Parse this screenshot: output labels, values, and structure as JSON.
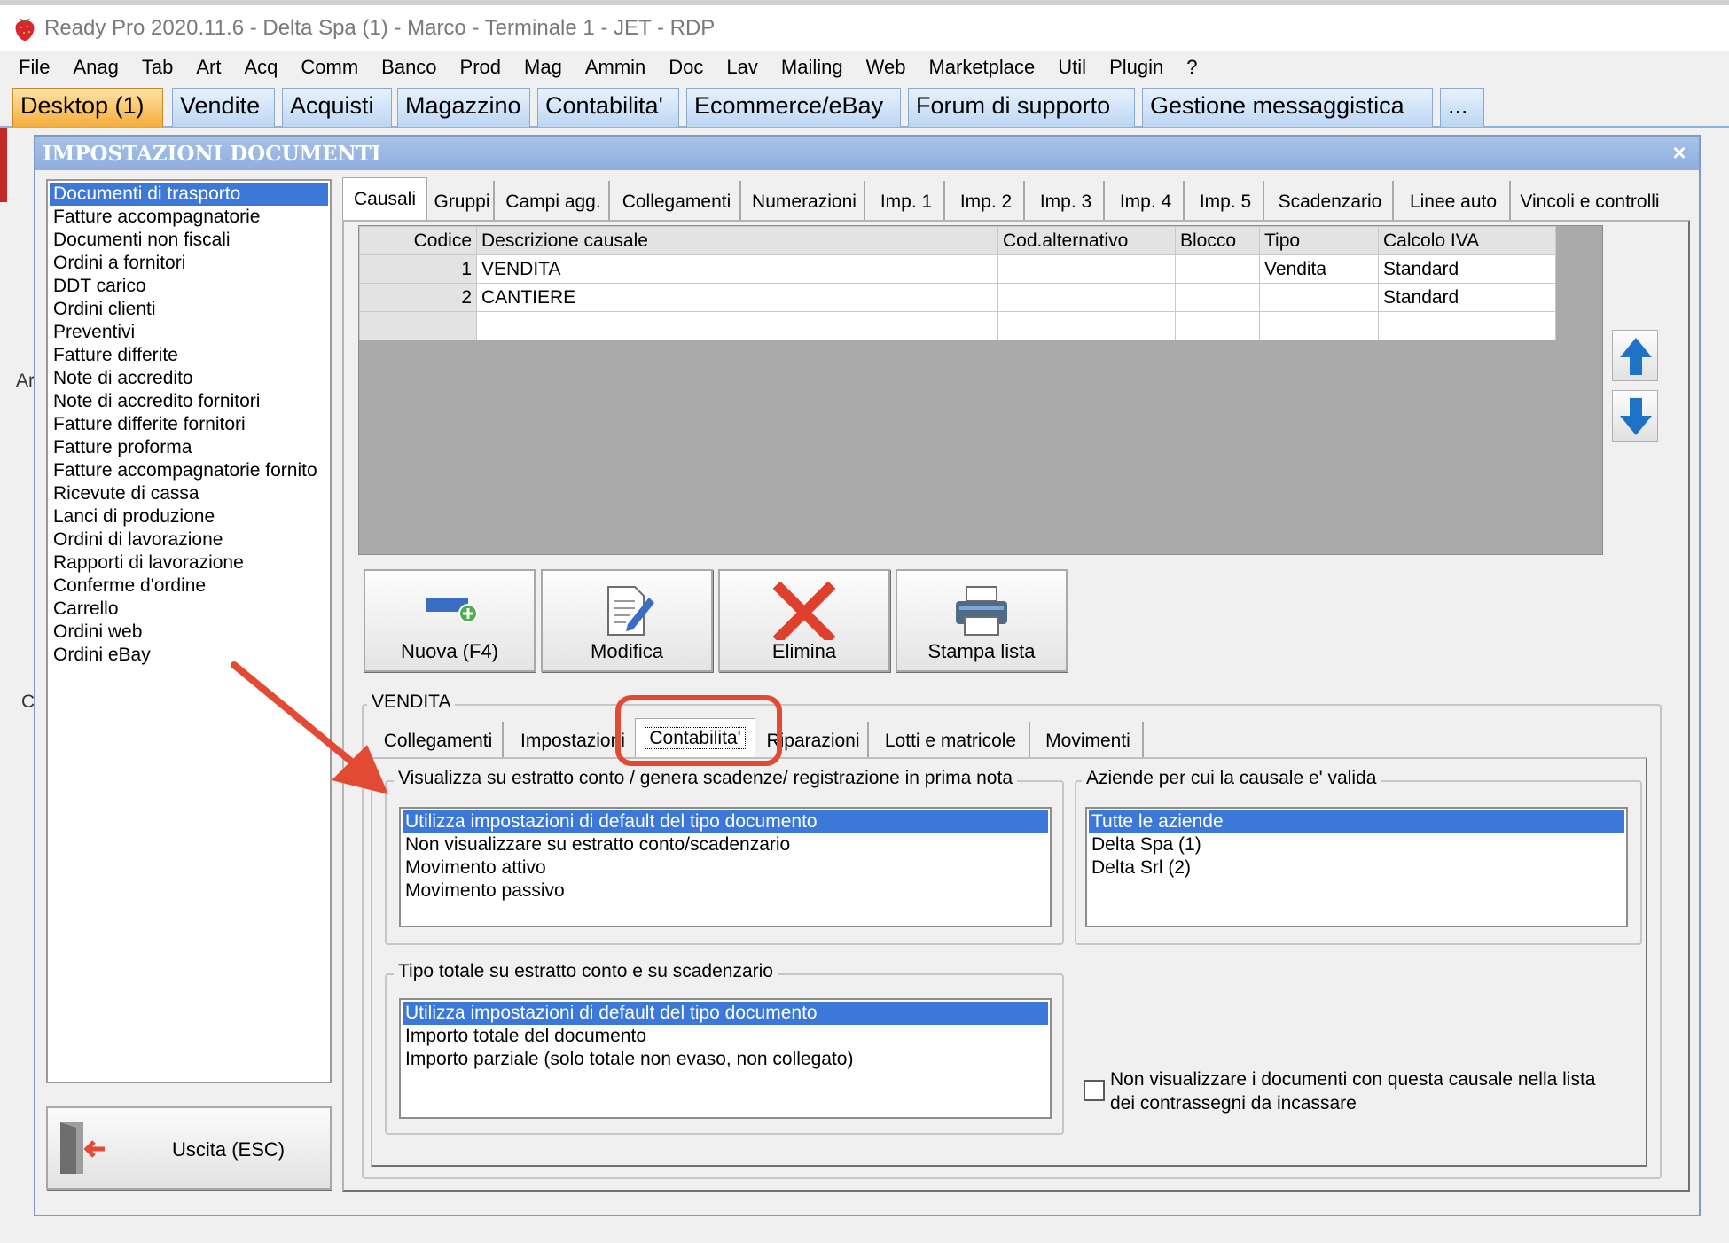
{
  "window": {
    "title": "Ready Pro 2020.11.6 - Delta Spa (1) - Marco - Terminale 1 - JET - RDP"
  },
  "menubar": [
    "File",
    "Anag",
    "Tab",
    "Art",
    "Acq",
    "Comm",
    "Banco",
    "Prod",
    "Mag",
    "Ammin",
    "Doc",
    "Lav",
    "Mailing",
    "Web",
    "Marketplace",
    "Util",
    "Plugin",
    "?"
  ],
  "top_tabs": [
    "Desktop (1)",
    "Vendite",
    "Acquisti",
    "Magazzino",
    "Contabilita'",
    "Ecommerce/eBay",
    "Forum di supporto",
    "Gestione messaggistica",
    "..."
  ],
  "background_chars": [
    "Ar",
    "C"
  ],
  "dialog": {
    "title": "IMPOSTAZIONI DOCUMENTI",
    "close_label": "×",
    "doc_types": [
      "Documenti di trasporto",
      "Fatture accompagnatorie",
      "Documenti non fiscali",
      "Ordini a fornitori",
      "DDT carico",
      "Ordini clienti",
      "Preventivi",
      "Fatture differite",
      "Note di accredito",
      "Note di accredito fornitori",
      "Fatture differite fornitori",
      "Fatture proforma",
      "Fatture accompagnatorie fornito",
      "Ricevute di cassa",
      "Lanci di produzione",
      "Ordini di lavorazione",
      "Rapporti di lavorazione",
      "Conferme d'ordine",
      "Carrello",
      "Ordini web",
      "Ordini eBay"
    ],
    "exit_label": "Uscita (ESC)",
    "main_tabs": [
      "Causali",
      "Gruppi",
      "Campi agg.",
      "Collegamenti",
      "Numerazioni",
      "Imp. 1",
      "Imp. 2",
      "Imp. 3",
      "Imp. 4",
      "Imp. 5",
      "Scadenzario",
      "Linee auto",
      "Vincoli e controlli"
    ],
    "grid": {
      "columns": [
        "Codice",
        "Descrizione causale",
        "Cod.alternativo",
        "Blocco",
        "Tipo",
        "Calcolo IVA"
      ],
      "rows": [
        {
          "codice": "1",
          "descrizione": "VENDITA",
          "cod_alt": "",
          "blocco": "",
          "tipo": "Vendita",
          "iva": "Standard"
        },
        {
          "codice": "2",
          "descrizione": "CANTIERE",
          "cod_alt": "",
          "blocco": "",
          "tipo": "",
          "iva": "Standard"
        }
      ]
    },
    "buttons": {
      "nuova": "Nuova (F4)",
      "modifica": "Modifica",
      "elimina": "Elimina",
      "stampa": "Stampa lista"
    },
    "group_title": "VENDITA",
    "sub_tabs": [
      "Collegamenti",
      "Impostazioni",
      "Contabilita'",
      "Riparazioni",
      "Lotti e matricole",
      "Movimenti"
    ],
    "estratto": {
      "title": "Visualizza su estratto conto / genera scadenze/ registrazione  in prima nota",
      "options": [
        "Utilizza impostazioni di default del tipo documento",
        "Non visualizzare su estratto conto/scadenzario",
        "Movimento attivo",
        "Movimento passivo"
      ]
    },
    "aziende": {
      "title": "Aziende per cui la causale e' valida",
      "options": [
        "Tutte le aziende",
        "Delta Spa (1)",
        "Delta Srl (2)"
      ]
    },
    "tipo_totale": {
      "title": "Tipo totale su estratto conto e su scadenzario",
      "options": [
        "Utilizza impostazioni di default del tipo documento",
        "Importo totale del documento",
        "Importo parziale (solo totale non evaso, non collegato)"
      ]
    },
    "checkbox_label": "Non visualizzare i documenti con questa causale nella lista dei contrassegni da incassare"
  },
  "colors": {
    "selection": "#3b78d8",
    "annotation": "#e24a33",
    "active_tab": "#f6ad3a",
    "tab": "#bcd6f4"
  }
}
